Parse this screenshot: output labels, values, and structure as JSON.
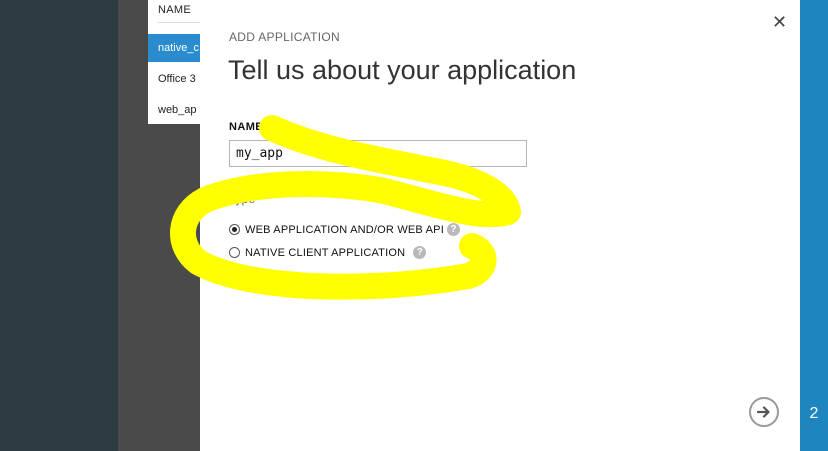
{
  "background": {
    "list_header": "NAME",
    "list_items": [
      "native_c",
      "Office 3",
      "web_ap"
    ],
    "step_number": "2"
  },
  "dialog": {
    "kicker": "ADD APPLICATION",
    "title": "Tell us about your application",
    "close_icon": "close-icon",
    "name_label": "NAME",
    "name_value": "my_app",
    "type_label": "Type",
    "options": [
      {
        "label": "WEB APPLICATION AND/OR WEB API",
        "selected": true
      },
      {
        "label": "NATIVE CLIENT APPLICATION",
        "selected": false
      }
    ],
    "help_icon": "help-icon",
    "next_icon": "arrow-right-circle-icon"
  },
  "colors": {
    "accent": "#1e85be",
    "highlight": "#ffff00"
  }
}
